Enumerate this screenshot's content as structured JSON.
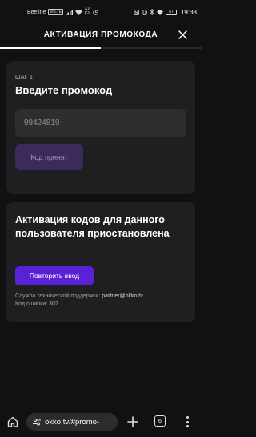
{
  "status_bar": {
    "carrier": "Beeline",
    "network_chip": "VoLTE",
    "net_speed_value": "4,6",
    "net_speed_unit": "K/s",
    "battery": "67",
    "time": "19:38"
  },
  "header": {
    "title": "АКТИВАЦИЯ ПРОМОКОДА",
    "progress": 0.5
  },
  "step_card": {
    "step_label": "ШАГ 1",
    "title": "Введите промокод",
    "input_value": "99424819",
    "accepted_button": "Код принят"
  },
  "error_card": {
    "title": "Активация кодов для данного пользователя приостановлена",
    "retry_button": "Повторить ввод",
    "support_label": "Служба технической поддержки:",
    "support_email": "partner@okko.tv",
    "error_code": "Код ошибки: 302"
  },
  "browser": {
    "url": "okko.tv/#promo-",
    "tab_count": "6"
  },
  "colors": {
    "background": "#111111",
    "card": "#1f1f21",
    "accent": "#5a22d6",
    "accepted_button": "#3b2a5a"
  }
}
